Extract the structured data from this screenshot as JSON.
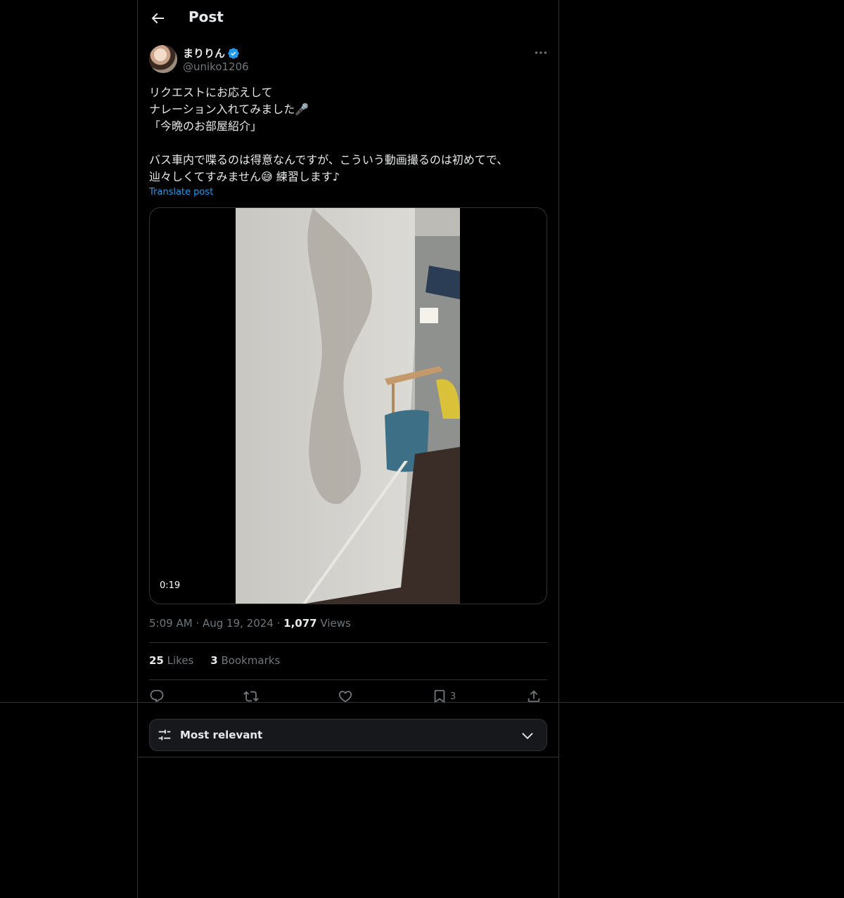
{
  "header": {
    "title": "Post",
    "back_icon": "arrow-left-icon"
  },
  "author": {
    "name": "まりりん",
    "handle": "@uniko1206",
    "verified": true
  },
  "tweet": {
    "text": "リクエストにお応えして\nナレーション入れてみました🎤\n「今晩のお部屋紹介」\n\nバス車内で喋るのは得意なんですが、こういう動画撮るのは初めてで、\n辿々しくてすみません😅 練習します♪",
    "translate_label": "Translate post"
  },
  "media": {
    "duration": "0:19"
  },
  "meta": {
    "time": "5:09 AM",
    "date": "Aug 19, 2024",
    "views_count": "1,077",
    "views_label": "Views"
  },
  "stats": {
    "likes_count": "25",
    "likes_label": "Likes",
    "bookmarks_count": "3",
    "bookmarks_label": "Bookmarks"
  },
  "actions": {
    "reply_icon": "reply-icon",
    "repost_icon": "repost-icon",
    "like_icon": "heart-icon",
    "bookmark_icon": "bookmark-icon",
    "bookmark_count": "3",
    "share_icon": "share-icon"
  },
  "sort": {
    "label": "Most relevant"
  },
  "colors": {
    "background": "#000000",
    "accent": "#1d9bf0",
    "muted": "#71767b",
    "border": "#2f3336"
  }
}
